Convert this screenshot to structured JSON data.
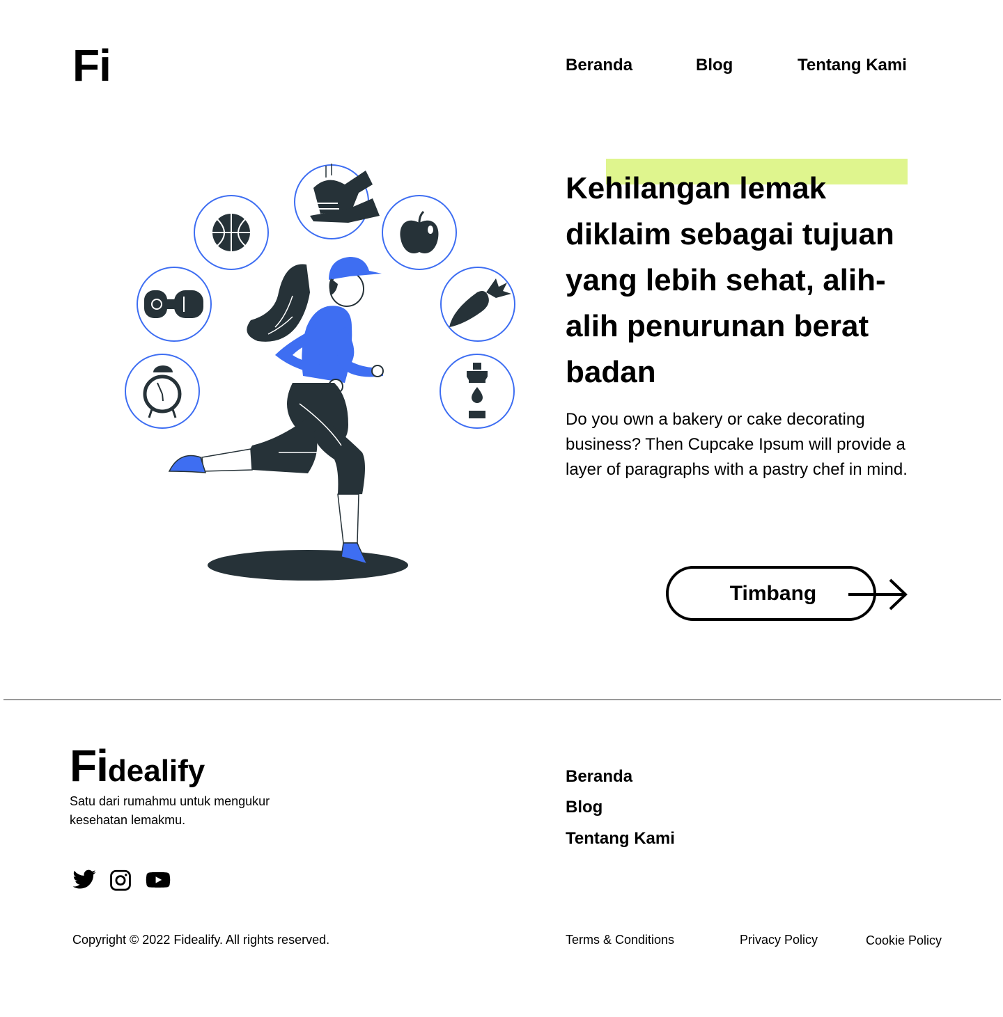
{
  "header": {
    "logo": "Fi",
    "nav": [
      "Beranda",
      "Blog",
      "Tentang Kami"
    ]
  },
  "hero": {
    "title": "Kehilangan lemak diklaim sebagai tujuan yang lebih sehat, alih-alih penurunan berat badan",
    "description": "Do you own a bakery or cake decorating business? Then Cupcake Ipsum will provide a layer of paragraphs with a pastry chef in mind.",
    "cta_label": "Timbang",
    "illustration_icons": [
      "alarm-clock-icon",
      "dumbbell-icon",
      "basketball-icon",
      "handwash-icon",
      "apple-icon",
      "carrot-icon",
      "water-bottle-icon"
    ]
  },
  "footer": {
    "brand_fi": "Fi",
    "brand_rest": "dealify",
    "tagline": "Satu dari rumahmu untuk mengukur kesehatan lemakmu.",
    "social": [
      "twitter-icon",
      "instagram-icon",
      "youtube-icon"
    ],
    "nav": [
      "Beranda",
      "Blog",
      "Tentang Kami"
    ],
    "copyright": "Copyright © 2022 Fidealify. All rights reserved.",
    "legal": [
      "Terms & Conditions",
      "Privacy Policy",
      "Cookie Policy"
    ]
  },
  "colors": {
    "accent_blue": "#3e6ef2",
    "dark": "#263238",
    "highlight": "#dff58e",
    "divider": "#9a9a9a"
  }
}
